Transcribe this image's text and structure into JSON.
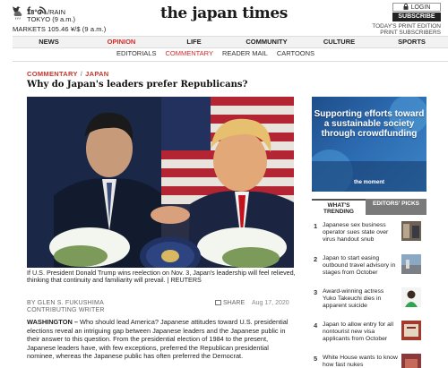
{
  "header": {
    "logo": "the japan times",
    "weather": {
      "temp": "18°C",
      "condition": "L/RAIN",
      "location": "TOKYO (9 a.m.)",
      "icon": "rain-cloud-icon"
    },
    "markets": "MARKETS 105.46 ¥/$ (9 a.m.)",
    "login_label": "LOGIN",
    "subscribe_label": "SUBSCRIBE",
    "print_edition": "TODAY'S PRINT EDITION",
    "print_subscribers": "PRINT SUBSCRIBERS"
  },
  "nav": {
    "items": [
      "NEWS",
      "OPINION",
      "LIFE",
      "COMMUNITY",
      "CULTURE",
      "SPORTS"
    ],
    "active": "OPINION"
  },
  "subnav": {
    "items": [
      "EDITORIALS",
      "COMMENTARY",
      "READER MAIL",
      "CARTOONS"
    ],
    "active": "COMMENTARY"
  },
  "article": {
    "crumb_section": "COMMENTARY",
    "crumb_region": "JAPAN",
    "title": "Why do Japan's leaders prefer Republicans?",
    "caption": "If U.S. President Donald Trump wins reelection on Nov. 3, Japan's leadership will feel relieved, thinking that continuity and familiarity will prevail. | REUTERS",
    "byline_author": "BY GLEN S. FUKUSHIMA",
    "byline_role": "CONTRIBUTING WRITER",
    "share_label": "SHARE",
    "date": "Aug 17, 2020",
    "dateline": "WASHINGTON –",
    "body": "Who should lead America? Japanese attitudes toward U.S. presidential elections reveal an intriguing gap between Japanese leaders and the Japanese public in their answer to this question. From the presidential election of 1984 to the present, Japanese leaders have, with few exceptions, preferred the Republican presidential nominee, whereas the Japanese public has often preferred the Democrat."
  },
  "ad": {
    "text": "Supporting efforts toward a sustainable society through crowdfunding",
    "brand": "the moment"
  },
  "sidebar": {
    "tab_trending": "WHAT'S TRENDING",
    "tab_picks": "EDITORS' PICKS",
    "trending": [
      {
        "num": "1",
        "title": "Japanese sex business operator sues state over virus handout snub"
      },
      {
        "num": "2",
        "title": "Japan to start easing outbound travel advisory in stages from October"
      },
      {
        "num": "3",
        "title": "Award-winning actress Yuko Takeuchi dies in apparent suicide"
      },
      {
        "num": "4",
        "title": "Japan to allow entry for all nontourist new visa applicants from October"
      },
      {
        "num": "5",
        "title": "White House wants to know how fast nukes"
      }
    ]
  },
  "colors": {
    "accent": "#d42a2a",
    "nav_bg": "#f2f2f2",
    "subscribe_bg": "#222222",
    "ad_bg": "#2c6ab0"
  }
}
